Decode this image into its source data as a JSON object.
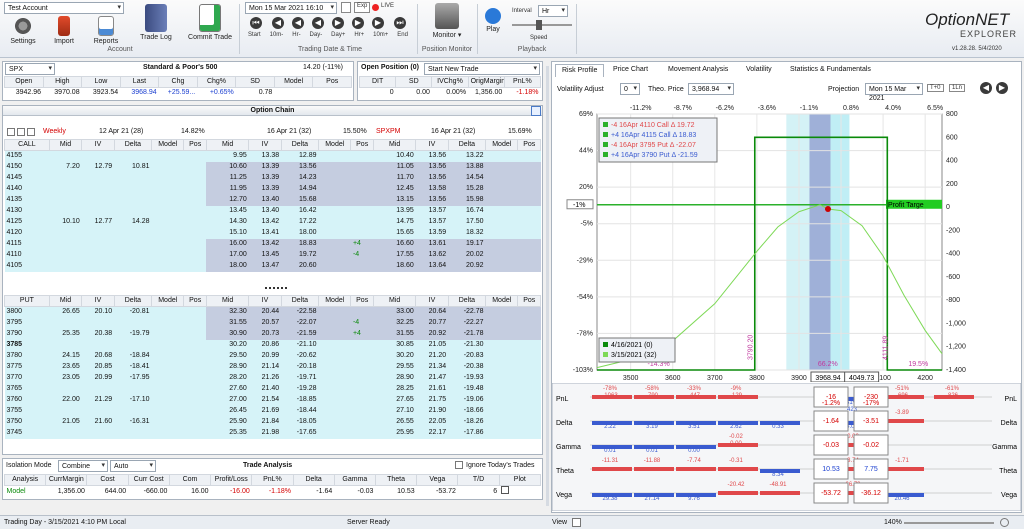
{
  "ribbon": {
    "account": "Test Account",
    "buttons": [
      {
        "label": "Settings",
        "icon": "settings-icon"
      },
      {
        "label": "Import",
        "icon": "import-icon"
      },
      {
        "label": "Reports",
        "icon": "reports-icon"
      },
      {
        "label": "Trade Log",
        "icon": "trade-log-icon"
      },
      {
        "label": "Commit Trade",
        "icon": "commit-trade-icon"
      }
    ],
    "account_group": "Account",
    "datetime": "Mon 15 Mar 2021 16:10",
    "exp_label": "Exp",
    "live_label": "LIVE",
    "nav_labels": [
      "Start",
      "10m-",
      "Hr-",
      "Day-",
      "Day+",
      "Hr+",
      "10m+",
      "End"
    ],
    "datetime_group": "Trading Date & Time",
    "monitor_label": "Monitor",
    "monitor_group": "Position Monitor",
    "play_label": "Play",
    "interval_label": "Interval",
    "interval_value": "Hr",
    "speed_label": "Speed",
    "playback_group": "Playback",
    "brand_main": "OptionNET",
    "brand_sub": "EXPLORER",
    "version": "v1.28.28. 5/4/2020"
  },
  "underlying": {
    "symbol": "SPX",
    "title": "Standard & Poor's 500",
    "iv_text": "14.20 (-11%)",
    "headers": [
      "Open",
      "High",
      "Low",
      "Last",
      "Chg",
      "Chg%",
      "SD",
      "Model",
      "Pos"
    ],
    "values": [
      "3942.96",
      "3970.08",
      "3923.54",
      "3968.94",
      "+25.59...",
      "+0.65%",
      "0.78",
      "",
      ""
    ]
  },
  "open_position": {
    "title": "Open Position (0)",
    "trade": "Start New Trade",
    "headers": [
      "DIT",
      "SD",
      "IVChg%",
      "OrigMargin",
      "PnL%"
    ],
    "values": [
      "0",
      "0.00",
      "0.00%",
      "1,356.00",
      "-1.18%"
    ]
  },
  "option_chain": {
    "title": "Option Chain",
    "exp1": {
      "name": "Weekly",
      "date": "12 Apr 21 (28)",
      "iv": "14.82%"
    },
    "exp2": {
      "name": "",
      "date": "16 Apr 21 (32)",
      "iv": "15.50%"
    },
    "exp3": {
      "name": "SPXPM",
      "date": "16 Apr 21 (32)",
      "iv": "15.69%"
    },
    "col_headers": [
      "Mid",
      "IV",
      "Delta",
      "Model",
      "Pos"
    ],
    "call_label": "CALL",
    "put_label": "PUT",
    "calls": [
      {
        "strike": "4155",
        "a": [
          "",
          "",
          "",
          "",
          ""
        ],
        "b": [
          "9.95",
          "13.38",
          "12.89",
          "",
          ""
        ],
        "c": [
          "10.40",
          "13.56",
          "13.22",
          "",
          ""
        ]
      },
      {
        "strike": "4150",
        "a": [
          "7.20",
          "12.79",
          "10.81",
          "",
          ""
        ],
        "b": [
          "10.60",
          "13.39",
          "13.56",
          "",
          ""
        ],
        "c": [
          "11.05",
          "13.56",
          "13.88",
          "",
          ""
        ]
      },
      {
        "strike": "4145",
        "a": [
          "",
          "",
          "",
          "",
          ""
        ],
        "b": [
          "11.25",
          "13.39",
          "14.23",
          "",
          ""
        ],
        "c": [
          "11.70",
          "13.56",
          "14.54",
          "",
          ""
        ]
      },
      {
        "strike": "4140",
        "a": [
          "",
          "",
          "",
          "",
          ""
        ],
        "b": [
          "11.95",
          "13.39",
          "14.94",
          "",
          ""
        ],
        "c": [
          "12.45",
          "13.58",
          "15.28",
          "",
          ""
        ]
      },
      {
        "strike": "4135",
        "a": [
          "",
          "",
          "",
          "",
          ""
        ],
        "b": [
          "12.70",
          "13.40",
          "15.68",
          "",
          ""
        ],
        "c": [
          "13.15",
          "13.56",
          "15.98",
          "",
          ""
        ]
      },
      {
        "strike": "4130",
        "a": [
          "",
          "",
          "",
          "",
          ""
        ],
        "b": [
          "13.45",
          "13.40",
          "16.42",
          "",
          ""
        ],
        "c": [
          "13.95",
          "13.57",
          "16.74",
          "",
          ""
        ]
      },
      {
        "strike": "4125",
        "a": [
          "10.10",
          "12.77",
          "14.28",
          "",
          ""
        ],
        "b": [
          "14.30",
          "13.42",
          "17.22",
          "",
          ""
        ],
        "c": [
          "14.75",
          "13.57",
          "17.50",
          "",
          ""
        ]
      },
      {
        "strike": "4120",
        "a": [
          "",
          "",
          "",
          "",
          ""
        ],
        "b": [
          "15.10",
          "13.41",
          "18.00",
          "",
          ""
        ],
        "c": [
          "15.65",
          "13.59",
          "18.32",
          "",
          ""
        ]
      },
      {
        "strike": "4115",
        "a": [
          "",
          "",
          "",
          "",
          ""
        ],
        "b": [
          "16.00",
          "13.42",
          "18.83",
          "",
          "+4"
        ],
        "c": [
          "16.60",
          "13.61",
          "19.17",
          "",
          ""
        ]
      },
      {
        "strike": "4110",
        "a": [
          "",
          "",
          "",
          "",
          ""
        ],
        "b": [
          "17.00",
          "13.45",
          "19.72",
          "",
          "-4"
        ],
        "c": [
          "17.55",
          "13.62",
          "20.02",
          "",
          ""
        ]
      },
      {
        "strike": "4105",
        "a": [
          "",
          "",
          "",
          "",
          ""
        ],
        "b": [
          "18.00",
          "13.47",
          "20.60",
          "",
          ""
        ],
        "c": [
          "18.60",
          "13.64",
          "20.92",
          "",
          ""
        ]
      }
    ],
    "puts": [
      {
        "strike": "3800",
        "a": [
          "26.65",
          "20.10",
          "-20.81",
          "",
          ""
        ],
        "b": [
          "32.30",
          "20.44",
          "-22.58",
          "",
          ""
        ],
        "c": [
          "33.00",
          "20.64",
          "-22.78",
          "",
          ""
        ]
      },
      {
        "strike": "3795",
        "a": [
          "",
          "",
          "",
          "",
          ""
        ],
        "b": [
          "31.55",
          "20.57",
          "-22.07",
          "",
          "-4"
        ],
        "c": [
          "32.25",
          "20.77",
          "-22.27",
          "",
          ""
        ]
      },
      {
        "strike": "3790",
        "a": [
          "25.35",
          "20.38",
          "-19.79",
          "",
          ""
        ],
        "b": [
          "30.90",
          "20.73",
          "-21.59",
          "",
          "+4"
        ],
        "c": [
          "31.55",
          "20.92",
          "-21.78",
          "",
          ""
        ]
      },
      {
        "strike": "3785",
        "a": [
          "",
          "",
          "",
          "",
          ""
        ],
        "b": [
          "30.20",
          "20.86",
          "-21.10",
          "",
          ""
        ],
        "c": [
          "30.85",
          "21.05",
          "-21.30",
          "",
          ""
        ]
      },
      {
        "strike": "3780",
        "a": [
          "24.15",
          "20.68",
          "-18.84",
          "",
          ""
        ],
        "b": [
          "29.50",
          "20.99",
          "-20.62",
          "",
          ""
        ],
        "c": [
          "30.20",
          "21.20",
          "-20.83",
          "",
          ""
        ]
      },
      {
        "strike": "3775",
        "a": [
          "23.65",
          "20.85",
          "-18.41",
          "",
          ""
        ],
        "b": [
          "28.90",
          "21.14",
          "-20.18",
          "",
          ""
        ],
        "c": [
          "29.55",
          "21.34",
          "-20.38",
          "",
          ""
        ]
      },
      {
        "strike": "3770",
        "a": [
          "23.05",
          "20.99",
          "-17.95",
          "",
          ""
        ],
        "b": [
          "28.20",
          "21.26",
          "-19.71",
          "",
          ""
        ],
        "c": [
          "28.90",
          "21.47",
          "-19.93",
          "",
          ""
        ]
      },
      {
        "strike": "3765",
        "a": [
          "",
          "",
          "",
          "",
          ""
        ],
        "b": [
          "27.60",
          "21.40",
          "-19.28",
          "",
          ""
        ],
        "c": [
          "28.25",
          "21.61",
          "-19.48",
          "",
          ""
        ]
      },
      {
        "strike": "3760",
        "a": [
          "22.00",
          "21.29",
          "-17.10",
          "",
          ""
        ],
        "b": [
          "27.00",
          "21.54",
          "-18.85",
          "",
          ""
        ],
        "c": [
          "27.65",
          "21.75",
          "-19.06",
          "",
          ""
        ]
      },
      {
        "strike": "3755",
        "a": [
          "",
          "",
          "",
          "",
          ""
        ],
        "b": [
          "26.45",
          "21.69",
          "-18.44",
          "",
          ""
        ],
        "c": [
          "27.10",
          "21.90",
          "-18.66",
          "",
          ""
        ]
      },
      {
        "strike": "3750",
        "a": [
          "21.05",
          "21.60",
          "-16.31",
          "",
          ""
        ],
        "b": [
          "25.90",
          "21.84",
          "-18.05",
          "",
          ""
        ],
        "c": [
          "26.55",
          "22.05",
          "-18.26",
          "",
          ""
        ]
      },
      {
        "strike": "3745",
        "a": [
          "",
          "",
          "",
          "",
          ""
        ],
        "b": [
          "25.35",
          "21.98",
          "-17.65",
          "",
          ""
        ],
        "c": [
          "25.95",
          "22.17",
          "-17.86",
          "",
          ""
        ]
      }
    ]
  },
  "trade_analysis": {
    "title": "Trade Analysis",
    "isolation_label": "Isolation Mode",
    "isolation_value": "Combine",
    "auto_value": "Auto",
    "ignore_label": "Ignore Today's Trades",
    "headers": [
      "Analysis",
      "CurrMargin",
      "Cost",
      "Curr Cost",
      "Com",
      "Profit/Loss",
      "PnL%",
      "Delta",
      "Gamma",
      "Theta",
      "Vega",
      "T/D",
      "Plot"
    ],
    "values": [
      "Model",
      "1,356.00",
      "644.00",
      "-660.00",
      "16.00",
      "-16.00",
      "-1.18%",
      "-1.64",
      "-0.03",
      "10.53",
      "-53.72",
      "6",
      ""
    ]
  },
  "risk": {
    "tabs": [
      "Risk Profile",
      "Price Chart",
      "Movement Analysis",
      "Volatility",
      "Statistics & Fundamentals"
    ],
    "vol_adjust_label": "Volatility Adjust",
    "vol_adjust_value": "0",
    "theo_label": "Theo. Price",
    "theo_value": "3,968.94",
    "projection_label": "Projection",
    "projection_value": "Mon 15 Mar 2021",
    "t0_label": "T+0",
    "oneln_label": "1Ln"
  },
  "chart_data": {
    "type": "line",
    "x_ticks": [
      "3500",
      "3600",
      "3700",
      "3800",
      "3900",
      "4000",
      "4100",
      "4200"
    ],
    "x_range": [
      3420,
      4240
    ],
    "top_pct_ticks": [
      "-11.2%",
      "-8.7%",
      "-6.2%",
      "-3.6%",
      "-1.1%",
      "0.8%",
      "4.0%",
      "6.5%"
    ],
    "y_left_ticks": [
      "69%",
      "44%",
      "20%",
      "-5%",
      "-29%",
      "-54%",
      "-78%",
      "-103%"
    ],
    "y_left_range": [
      -103,
      69
    ],
    "y_right_ticks": [
      "800",
      "600",
      "400",
      "200",
      "0",
      "-200",
      "-400",
      "-600",
      "-800",
      "-1,000",
      "-1,200",
      "-1,400"
    ],
    "y_right_range": [
      -1400,
      800
    ],
    "current_price": "3968.94",
    "cursor_price": "4049.73",
    "current_marker": "-1%",
    "profit_target_label": "Profit Targe",
    "strike_labels": [
      "3790.20",
      "4111.89"
    ],
    "pct_labels": [
      "-14.3%",
      "66.2%",
      "19.5%"
    ],
    "legend": [
      {
        "text": "-4 16Apr 4110 Call Δ  19.72",
        "color": "#e0484a"
      },
      {
        "text": "+4 16Apr 4115 Call Δ  18.83",
        "color": "#3a5bd0"
      },
      {
        "text": "-4 16Apr 3795 Put Δ  -22.07",
        "color": "#e0484a"
      },
      {
        "text": "+4 16Apr 3790 Put Δ  -21.59",
        "color": "#3a5bd0"
      }
    ],
    "series": [
      {
        "name": "4/16/2021 (0)",
        "color": "#0a8a0a",
        "x": [
          3420,
          3785,
          3795,
          3795,
          4110,
          4110,
          4120,
          4240
        ],
        "y": [
          -1400,
          -1400,
          -1400,
          600,
          600,
          -1400,
          -1400,
          -1400
        ]
      },
      {
        "name": "3/15/2021 (32)",
        "color": "#7ed957",
        "x": [
          3420,
          3500,
          3600,
          3700,
          3800,
          3850,
          3900,
          3950,
          3969,
          4000,
          4050,
          4100,
          4150,
          4200,
          4240
        ],
        "y": [
          -1380,
          -1310,
          -1150,
          -830,
          -380,
          -170,
          -40,
          20,
          -16,
          -30,
          -160,
          -420,
          -760,
          -1060,
          -1260
        ]
      }
    ]
  },
  "greeks": {
    "labels_left": [
      "PnL",
      "Delta",
      "Gamma",
      "Theta",
      "Vega"
    ],
    "center_a": [
      "-16\n-1.2%",
      "-1.64",
      "-0.03",
      "10.53",
      "-53.72"
    ],
    "center_b": [
      "-230\n-17%",
      "-3.51",
      "-0.02",
      "7.75",
      "-36.12"
    ],
    "bars_neg_top": [
      "-78%\n-1063",
      "-58%\n-790",
      "-33%\n-447",
      "-9%\n-129",
      "",
      "31%\n423",
      "-51%\n-696",
      "-61%\n-826"
    ],
    "bars_delta": [
      "2.22",
      "3.19",
      "3.51",
      "2.62",
      "0.33",
      "4.07",
      "-3.89",
      ""
    ],
    "bars_gamma": [
      "0.01",
      "0.01",
      "0.00",
      "-0.02\n0.00",
      "",
      "-0.02",
      "",
      ""
    ],
    "bars_theta": [
      "-11.31",
      "-11.88",
      "-7.74",
      "-0.31",
      "8.34",
      "-3.74",
      "-1.71",
      ""
    ],
    "bars_vega": [
      "29.38",
      "27.14",
      "9.76",
      "-20.42",
      "-48.91",
      "-26.73",
      "20.46",
      ""
    ]
  },
  "statusbar": {
    "left": "Trading Day - 3/15/2021 4:10 PM Local",
    "server": "Server Ready",
    "view": "View",
    "zoom": "140%"
  }
}
